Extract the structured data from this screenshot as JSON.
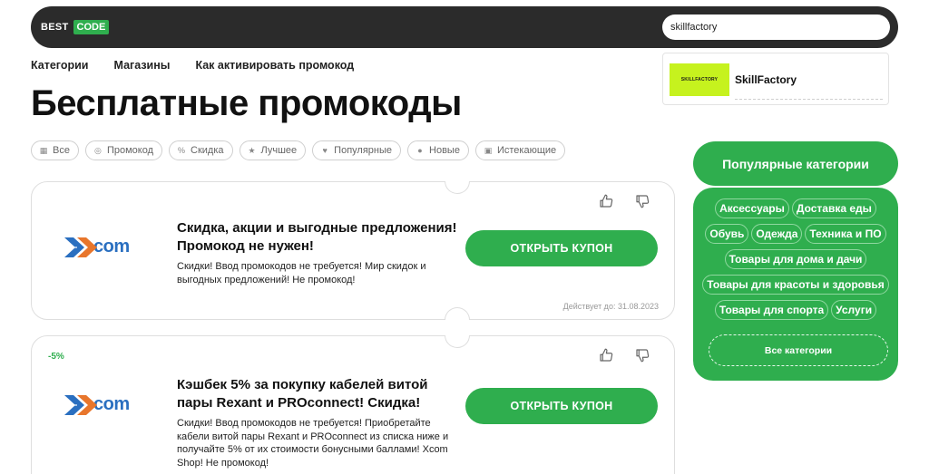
{
  "header": {
    "logo_best": "BEST",
    "logo_code": "CODE",
    "search_value": "skillfactory",
    "accent_color": "#2fae4e"
  },
  "nav": [
    "Категории",
    "Магазины",
    "Как активировать промокод"
  ],
  "dropdown": {
    "thumb_text": "SKILLFACTORY",
    "name": "SkillFactory"
  },
  "page_title": "Бесплатные промокоды",
  "filters": [
    {
      "label": "Все",
      "icon": "grid-icon"
    },
    {
      "label": "Промокод",
      "icon": "tag-icon"
    },
    {
      "label": "Скидка",
      "icon": "percent-icon"
    },
    {
      "label": "Лучшее",
      "icon": "star-icon"
    },
    {
      "label": "Популярные",
      "icon": "heart-icon"
    },
    {
      "label": "Новые",
      "icon": "info-icon"
    },
    {
      "label": "Истекающие",
      "icon": "calendar-icon"
    }
  ],
  "coupons": [
    {
      "brand": "com",
      "badge": "",
      "title": "Скидка, акции и выгодные предложения! Промокод не нужен!",
      "description": "Скидки! Ввод промокодов не требуется! Мир скидок и выгодных предложений! Не промокод!",
      "button": "ОТКРЫТЬ КУПОН",
      "valid_until": "Действует до: 31.08.2023"
    },
    {
      "brand": "com",
      "badge": "-5%",
      "title": "Кэшбек 5% за покупку кабелей витой пары Rexant и PROconnect! Скидка!",
      "description": "Скидки! Ввод промокодов не требуется! Приобретайте кабели витой пары Rexant и PROconnect из списка ниже и получайте 5% от их стоимости бонусными баллами! Xcom Shop! Не промокод!",
      "button": "ОТКРЫТЬ КУПОН",
      "valid_until": ""
    }
  ],
  "popular": {
    "title": "Популярные категории",
    "tags": [
      "Аксессуары",
      "Доставка еды",
      "Обувь",
      "Одежда",
      "Техника и ПО",
      "Товары для дома и дачи",
      "Товары для красоты и здоровья",
      "Товары для спорта",
      "Услуги"
    ],
    "all_button": "Все категории"
  }
}
